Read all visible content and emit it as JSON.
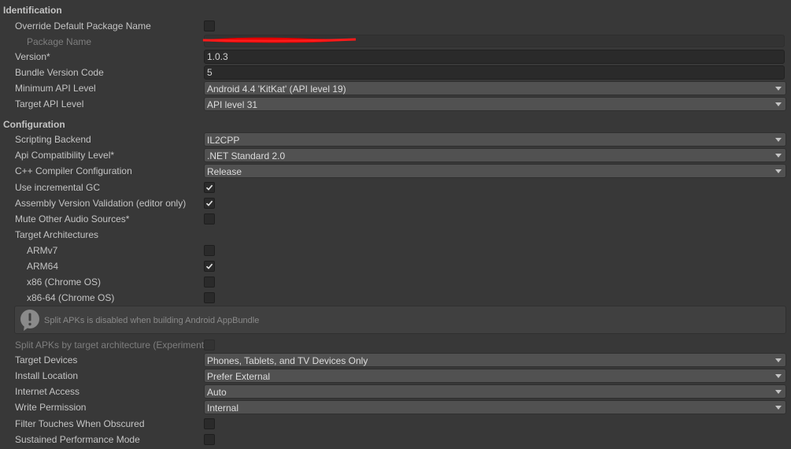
{
  "identification": {
    "header": "Identification",
    "override_package_name": {
      "label": "Override Default Package Name",
      "checked": false
    },
    "package_name": {
      "label": "Package Name",
      "value": ""
    },
    "version": {
      "label": "Version*",
      "value": "1.0.3"
    },
    "bundle_version_code": {
      "label": "Bundle Version Code",
      "value": "5"
    },
    "min_api_level": {
      "label": "Minimum API Level",
      "value": "Android 4.4 'KitKat' (API level 19)"
    },
    "target_api_level": {
      "label": "Target API Level",
      "value": "API level 31"
    }
  },
  "configuration": {
    "header": "Configuration",
    "scripting_backend": {
      "label": "Scripting Backend",
      "value": "IL2CPP"
    },
    "api_compat_level": {
      "label": "Api Compatibility Level*",
      "value": ".NET Standard 2.0"
    },
    "cpp_compiler_config": {
      "label": "C++ Compiler Configuration",
      "value": "Release"
    },
    "incremental_gc": {
      "label": "Use incremental GC",
      "checked": true
    },
    "assembly_version_validation": {
      "label": "Assembly Version Validation (editor only)",
      "checked": true
    },
    "mute_other_audio": {
      "label": "Mute Other Audio Sources*",
      "checked": false
    },
    "target_architectures": {
      "label": "Target Architectures",
      "items": [
        {
          "label": "ARMv7",
          "checked": false
        },
        {
          "label": "ARM64",
          "checked": true
        },
        {
          "label": "x86 (Chrome OS)",
          "checked": false
        },
        {
          "label": "x86-64 (Chrome OS)",
          "checked": false
        }
      ]
    },
    "split_apks_help": "Split APKs is disabled when building Android AppBundle",
    "split_apks": {
      "label": "Split APKs by target architecture (Experimental)",
      "checked": false
    },
    "target_devices": {
      "label": "Target Devices",
      "value": "Phones, Tablets, and TV Devices Only"
    },
    "install_location": {
      "label": "Install Location",
      "value": "Prefer External"
    },
    "internet_access": {
      "label": "Internet Access",
      "value": "Auto"
    },
    "write_permission": {
      "label": "Write Permission",
      "value": "Internal"
    },
    "filter_touches": {
      "label": "Filter Touches When Obscured",
      "checked": false
    },
    "sustained_performance": {
      "label": "Sustained Performance Mode",
      "checked": false
    }
  },
  "colors": {
    "background": "#383838",
    "field": "#2a2a2a",
    "dropdown": "#515151",
    "redaction": "#e00000"
  },
  "icons": {
    "checkmark": "checkmark-icon",
    "dropdown": "chevron-down-icon",
    "help": "warning-speech-bubble-icon"
  }
}
